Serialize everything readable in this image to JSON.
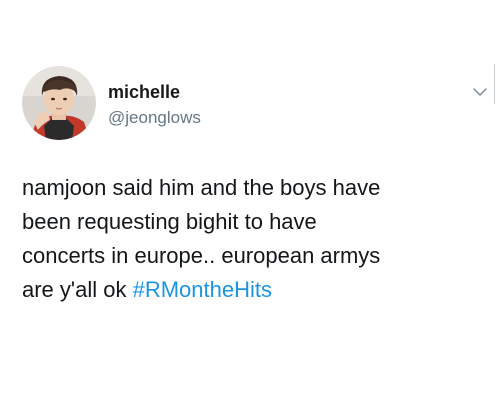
{
  "tweet": {
    "display_name": "michelle",
    "handle": "@jeonglows",
    "text_lines": [
      "namjoon said him and the boys have",
      "been requesting bighit to have",
      "concerts in europe.. european armys",
      "are y'all ok "
    ],
    "hashtag": "#RMontheHits",
    "menu_icon": "chevron-down-icon"
  },
  "colors": {
    "background": "#ffffff",
    "text": "#14171a",
    "handle": "#657786",
    "hashtag": "#1b95e0"
  }
}
